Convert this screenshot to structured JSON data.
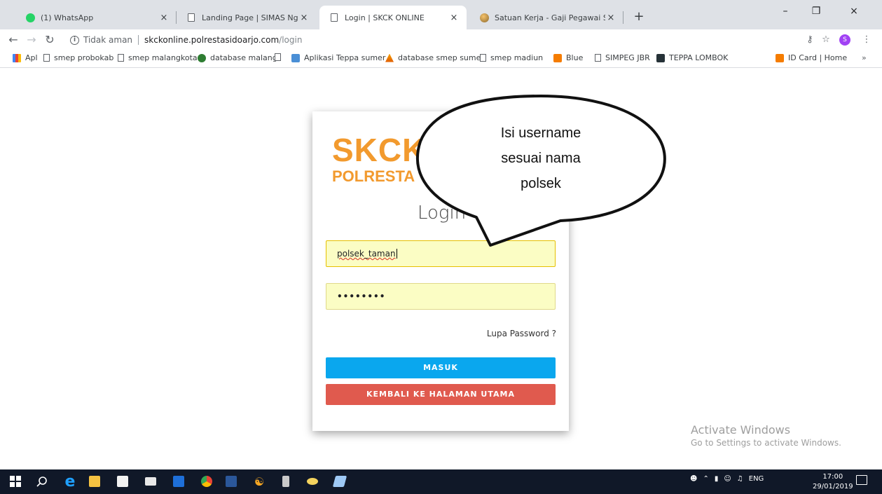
{
  "browser": {
    "tabs": [
      {
        "title": "(1) WhatsApp",
        "icon": "whatsapp-icon",
        "active": false
      },
      {
        "title": "Landing Page | SIMAS Nganjuk",
        "icon": "page-icon",
        "active": false
      },
      {
        "title": "Login | SKCK ONLINE",
        "icon": "page-icon",
        "active": true
      },
      {
        "title": "Satuan Kerja - Gaji Pegawai Sido",
        "icon": "globe-icon",
        "active": false
      }
    ],
    "new_tab_label": "+",
    "security_label": "Tidak aman",
    "url_host": "skckonline.polrestasidoarjo.com",
    "url_path": "/login",
    "profile_initial": "S",
    "bookmarks": [
      {
        "label": "Apl",
        "icon": "apps-icon"
      },
      {
        "label": "smep probokab",
        "icon": "page-icon"
      },
      {
        "label": "smep malangkota",
        "icon": "page-icon"
      },
      {
        "label": "database malang",
        "icon": "site-icon"
      },
      {
        "label": "",
        "icon": "page-icon"
      },
      {
        "label": "Aplikasi Teppa sumer",
        "icon": "site-icon"
      },
      {
        "label": "database smep sume",
        "icon": "site-icon"
      },
      {
        "label": "smep madiun",
        "icon": "page-icon"
      },
      {
        "label": "Blue",
        "icon": "blogger-icon"
      },
      {
        "label": "SIMPEG JBR",
        "icon": "page-icon"
      },
      {
        "label": "TEPPA LOMBOK",
        "icon": "site-icon"
      },
      {
        "label": "ID Card | Home",
        "icon": "site-icon"
      }
    ],
    "bookmarks_more": "»"
  },
  "login": {
    "brand_title": "SKCK",
    "brand_subtitle": "POLRESTA",
    "heading": "Login",
    "username_value": "polsek_taman",
    "password_mask": "••••••••",
    "forgot_label": "Lupa Password ?",
    "submit_label": "MASUK",
    "back_label": "KEMBALI KE HALAMAN UTAMA"
  },
  "annotation": {
    "line1": "Isi username",
    "line2": "sesuai nama",
    "line3": "polsek"
  },
  "watermark": {
    "title": "Activate Windows",
    "subtitle": "Go to Settings to activate Windows."
  },
  "taskbar": {
    "language": "ENG",
    "time": "17:00",
    "date": "29/01/2019"
  },
  "colors": {
    "brand_orange": "#f29a2e",
    "submit_blue": "#0aa7ee",
    "back_red": "#e05a4e",
    "field_yellow": "#fbfdc4"
  }
}
